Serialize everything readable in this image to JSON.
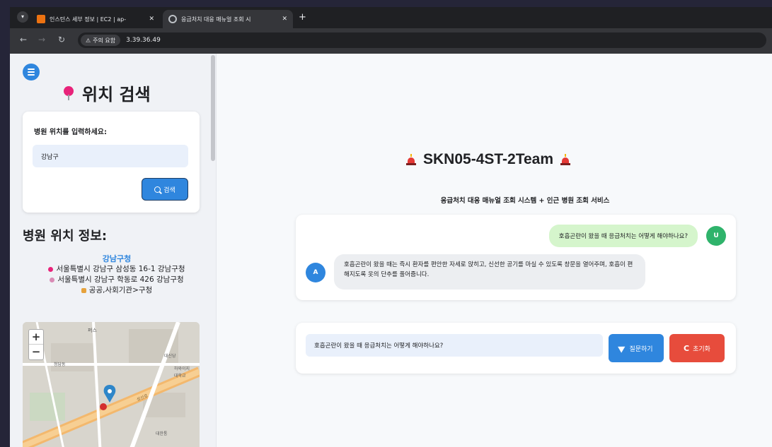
{
  "browser": {
    "tabs": [
      {
        "title": "인스턴스 세부 정보 | EC2 | ap-",
        "active": false,
        "favicon": "aws-icon"
      },
      {
        "title": "응급처치 대응 매뉴얼 조회 시",
        "active": true,
        "favicon": "globe-icon"
      }
    ],
    "security_label": "주의 요함",
    "url": "3.39.36.49"
  },
  "sidebar": {
    "title": "위치 검색",
    "search_label": "병원 위치를 입력하세요:",
    "search_value": "강남구",
    "search_button": "검색",
    "info_heading": "병원 위치 정보:",
    "place_name": "강남구청",
    "address_jibun": "서울특별시 강남구 삼성동 16-1 강남구청",
    "address_road": "서울특별시 강남구 학동로 426 강남구청",
    "category": "공공,사회기관>구청",
    "map_labels": [
      "퍼스",
      "대신당",
      "청담동",
      "하와이지",
      "대학교",
      "대한통",
      "성산로"
    ]
  },
  "main": {
    "title": "SKN05-4ST-2Team",
    "subtitle": "응급처치 대응 매뉴얼 조회 시스템 + 인근 병원 조회 서비스",
    "user_message": "호흡곤란이 왔을 때 응급처치는 어떻게 해야하나요?",
    "bot_message": "호흡곤란이 왔을 때는 즉시 환자를 편안한 자세로 앉히고, 신선한 공기를 마실 수 있도록 창문을 열어주며, 호흡이 편해지도록 옷의 단추를 풀어줍니다.",
    "user_avatar": "U",
    "bot_avatar": "A",
    "question_value": "호흡곤란이 왔을 때 응급처치는 어떻게 해야하나요?",
    "ask_button": "질문하기",
    "reset_button": "초기화"
  },
  "colors": {
    "accent": "#2f86de",
    "danger": "#e74c3c",
    "user_bubble": "#d5f5cc",
    "bot_bubble": "#eceef1"
  }
}
